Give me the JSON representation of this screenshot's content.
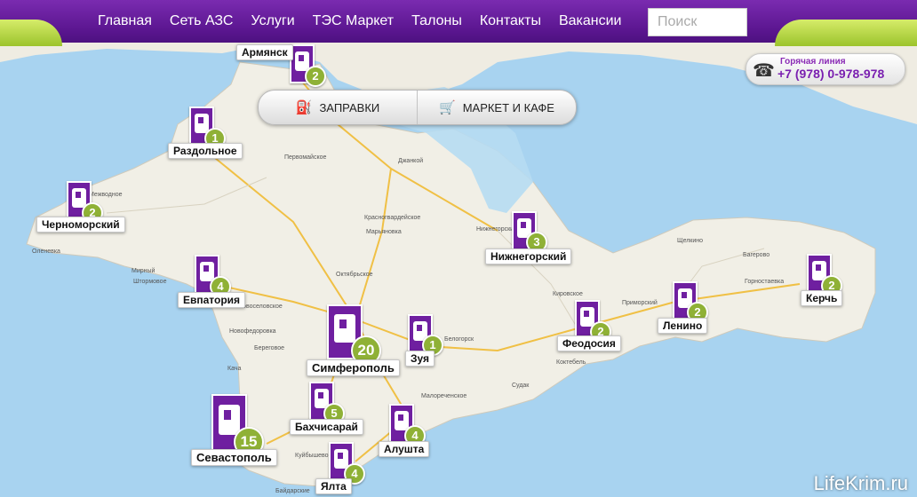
{
  "nav": {
    "items": [
      "Главная",
      "Сеть АЗС",
      "Услуги",
      "ТЭС Маркет",
      "Талоны",
      "Контакты",
      "Вакансии"
    ],
    "search_placeholder": "Поиск"
  },
  "hotline": {
    "title": "Горячая линия",
    "phone": "+7 (978) 0-978-978"
  },
  "filters": {
    "fuel": "ЗАПРАВКИ",
    "market": "МАРКЕТ И КАФЕ"
  },
  "stations": [
    {
      "name": "Армянск",
      "count": "2"
    },
    {
      "name": "Раздольное",
      "count": "1"
    },
    {
      "name": "Черноморский",
      "count": "2"
    },
    {
      "name": "Евпатория",
      "count": "4"
    },
    {
      "name": "Симферополь",
      "count": "20"
    },
    {
      "name": "Зуя",
      "count": "1"
    },
    {
      "name": "Нижнегорский",
      "count": "3"
    },
    {
      "name": "Феодосия",
      "count": "2"
    },
    {
      "name": "Ленино",
      "count": "2"
    },
    {
      "name": "Керчь",
      "count": "2"
    },
    {
      "name": "Бахчисарай",
      "count": "5"
    },
    {
      "name": "Алушта",
      "count": "4"
    },
    {
      "name": "Севастополь",
      "count": "15"
    },
    {
      "name": "Ялта",
      "count": "4"
    }
  ],
  "map_labels": [
    "Первомайское",
    "Джанкой",
    "Красногвардейское",
    "Октябрьское",
    "Кировское",
    "Приморский",
    "Щелкино",
    "Багерово",
    "Горностаевка",
    "Оленевка",
    "Мирный",
    "Штормовое",
    "Новофедоровка",
    "Береговое",
    "Белогорск",
    "Коктебель",
    "Судак",
    "Малореченское",
    "Кача",
    "Куйбышево",
    "Байдарские",
    "Марьяновка",
    "Новоселовское",
    "Межводное",
    "Нижнегорский"
  ],
  "watermark": "LifeKrim.ru",
  "colors": {
    "brand_purple": "#6f1fa0",
    "count_green": "#8fb136",
    "sea": "#a8d3f0",
    "land": "#f1efe6"
  }
}
